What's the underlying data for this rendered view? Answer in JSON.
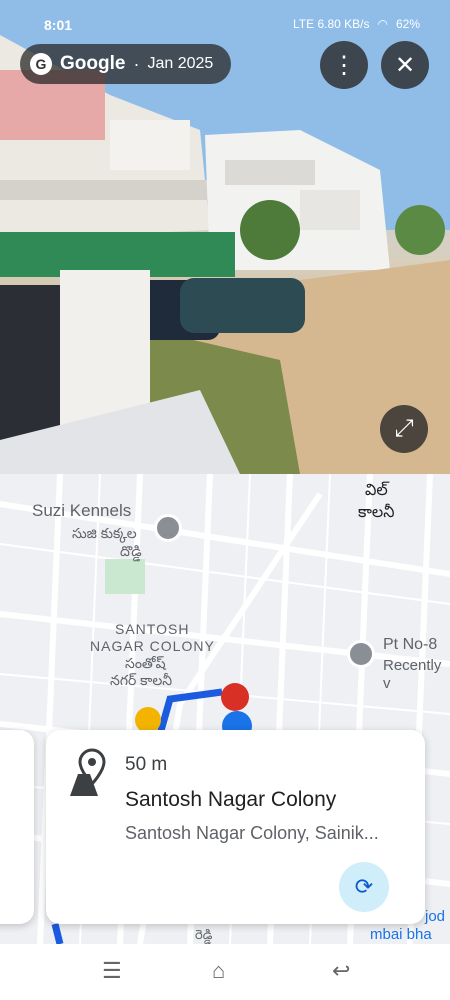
{
  "status": {
    "time": "8:01",
    "network": "LTE 6.80 KB/s",
    "battery": "62%"
  },
  "header": {
    "brand": "Google",
    "separator": "·",
    "date": "Jan 2025",
    "brand_initial": "G"
  },
  "map": {
    "labels": {
      "suzi_en": "Suzi Kennels",
      "suzi_te1": "సుజి కుక్కల",
      "suzi_te2": "దొడ్డి",
      "colony_en1": "SANTOSH",
      "colony_en2": "NAGAR COLONY",
      "colony_te1": "సంతోష్",
      "colony_te2": "నగర్ కాలనీ",
      "top_te1": "విల్",
      "top_te2": "కాలనీ",
      "pt": "Pt No-8",
      "recently": "Recently v",
      "bottom_right1": "jod",
      "bottom_right2": "mbai bha",
      "bottom_mid": "రెడ్డి"
    }
  },
  "card": {
    "distance": "50 m",
    "title": "Santosh Nagar Colony",
    "address": "Santosh Nagar Colony, Sainik..."
  },
  "colors": {
    "accent": "#0b57d0",
    "route": "#1a5be0"
  },
  "icons": {
    "menu": "menu-icon",
    "close": "close-icon",
    "expand": "expand-icon",
    "rotate": "rotate-icon",
    "pin": "location-pin-icon"
  }
}
